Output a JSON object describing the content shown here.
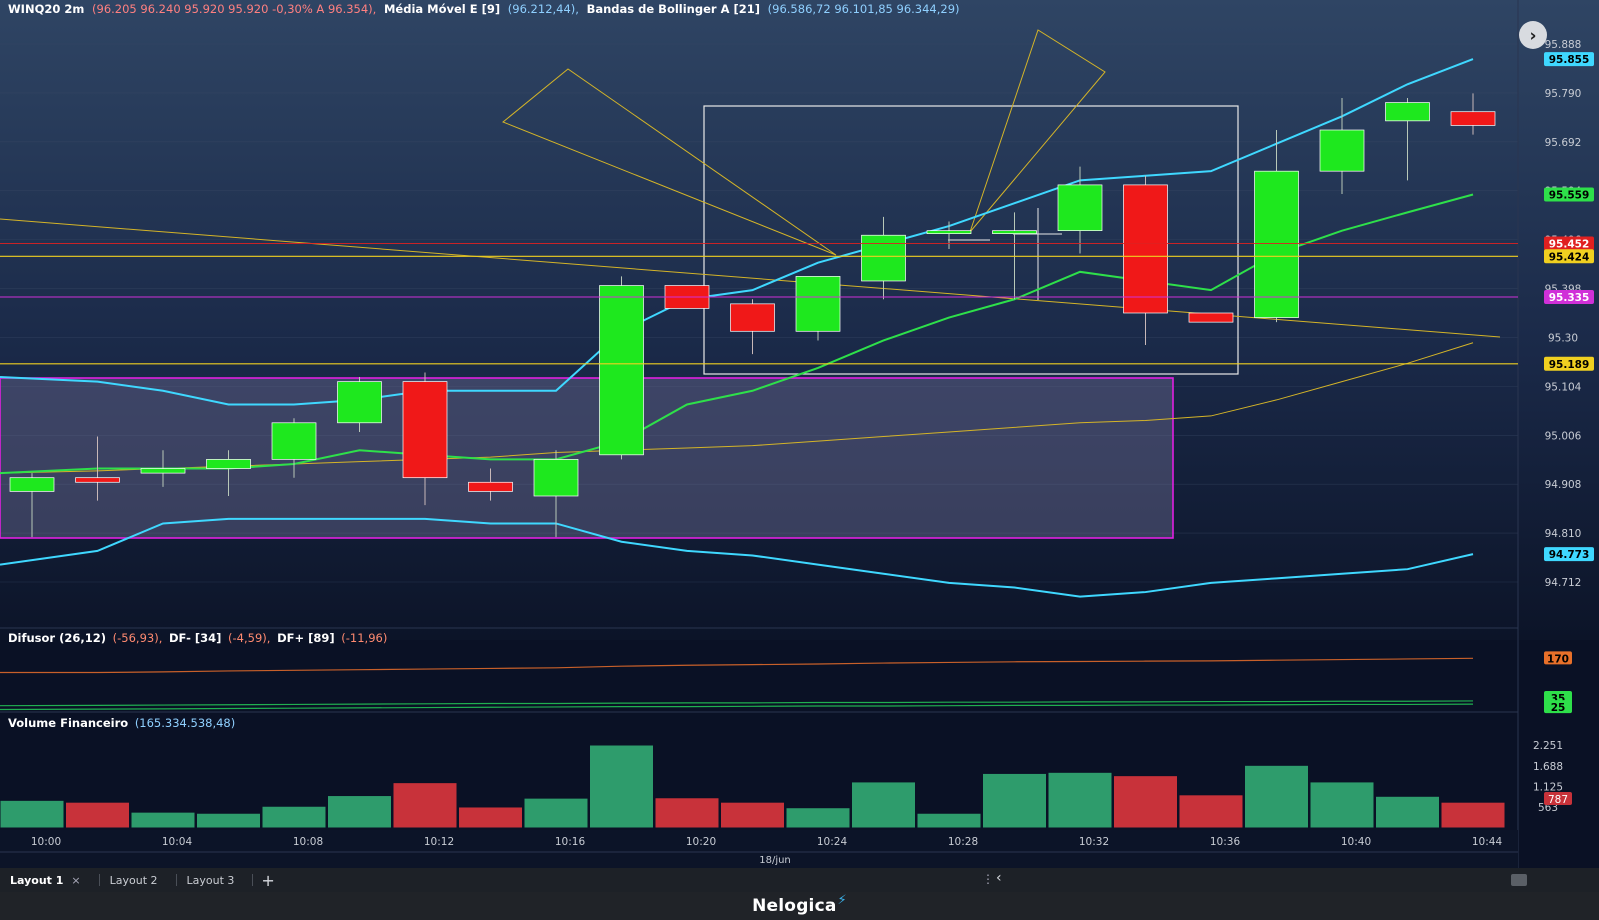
{
  "header": {
    "symbol": "WINQ20 2m",
    "ohlc": "(96.205  96.240  95.920  95.920  -0,30%  A 96.354),",
    "ema_label": "Média Móvel E [9]",
    "ema_values": "(96.212,44),",
    "bb_label": "Bandas de Bollinger A [21]",
    "bb_values": "(96.586,72  96.101,85 96.344,29)"
  },
  "price_axis": {
    "ticks": [
      "95.888",
      "95.790",
      "95.692",
      "95.594",
      "95.496",
      "95.398",
      "95.30",
      "95.104",
      "95.006",
      "94.908",
      "94.810",
      "94.712"
    ]
  },
  "price_labels": [
    {
      "text": "95.855",
      "color": "#3fd8ff"
    },
    {
      "text": "95.559",
      "color": "#2ee04a"
    },
    {
      "text": "95.452",
      "color": "#e02020"
    },
    {
      "text": "95.424",
      "color": "#f0d020"
    },
    {
      "text": "95.335",
      "color": "#d030d8"
    },
    {
      "text": "95.189",
      "color": "#f0d020"
    },
    {
      "text": "94.773",
      "color": "#3fd8ff"
    }
  ],
  "time_axis": {
    "ticks": [
      "10:00",
      "10:04",
      "10:08",
      "10:12",
      "10:16",
      "10:20",
      "10:24",
      "10:28",
      "10:32",
      "10:36",
      "10:40",
      "10:44"
    ],
    "date": "18/jun"
  },
  "difusor": {
    "label": "Difusor (26,12)",
    "value1": "(-56,93),",
    "df_minus": "DF- [34]",
    "value2": "(-4,59),",
    "df_plus": "DF+ [89]",
    "value3": "(-11,96)",
    "badges": [
      {
        "text": "170",
        "color": "#e8702a"
      },
      {
        "text": "35",
        "color": "#2ee04a"
      },
      {
        "text": "25",
        "color": "#2ee04a"
      }
    ]
  },
  "volume": {
    "label": "Volume Financeiro",
    "value": "(165.334.538,48)",
    "ticks": [
      "2.251",
      "1.688",
      "1.125",
      "563"
    ],
    "last_badge": "787"
  },
  "layout_tabs": [
    "Layout 1",
    "Layout 2",
    "Layout 3"
  ],
  "close_glyph": "×",
  "add_glyph": "+",
  "nav_glyph": "›",
  "footer": {
    "brand": "Nelogica"
  },
  "colors": {
    "bg": "#0c1428",
    "up": "#1ee81e",
    "down": "#f01818",
    "bb": "#3fd8ff",
    "ema": "#2ee04a",
    "vol_up": "#2e9c6c",
    "vol_down": "#c8323a"
  },
  "chart_data": {
    "type": "candlestick",
    "title": "WINQ20 2m",
    "x": [
      "10:00",
      "10:02",
      "10:04",
      "10:06",
      "10:08",
      "10:10",
      "10:12",
      "10:14",
      "10:16",
      "10:18",
      "10:20",
      "10:22",
      "10:24",
      "10:26",
      "10:28",
      "10:30",
      "10:32",
      "10:34",
      "10:36",
      "10:38",
      "10:40",
      "10:42",
      "10:44"
    ],
    "candles": [
      {
        "o": 94.91,
        "h": 94.95,
        "l": 94.81,
        "c": 94.94
      },
      {
        "o": 94.94,
        "h": 95.03,
        "l": 94.89,
        "c": 94.93
      },
      {
        "o": 94.95,
        "h": 95.0,
        "l": 94.92,
        "c": 94.96
      },
      {
        "o": 94.96,
        "h": 95.0,
        "l": 94.9,
        "c": 94.98
      },
      {
        "o": 94.98,
        "h": 95.07,
        "l": 94.94,
        "c": 95.06
      },
      {
        "o": 95.06,
        "h": 95.16,
        "l": 95.04,
        "c": 95.15
      },
      {
        "o": 95.15,
        "h": 95.17,
        "l": 94.88,
        "c": 94.94
      },
      {
        "o": 94.93,
        "h": 94.96,
        "l": 94.89,
        "c": 94.91
      },
      {
        "o": 94.9,
        "h": 95.0,
        "l": 94.81,
        "c": 94.98
      },
      {
        "o": 94.99,
        "h": 95.38,
        "l": 94.98,
        "c": 95.36
      },
      {
        "o": 95.36,
        "h": 95.36,
        "l": 95.31,
        "c": 95.31
      },
      {
        "o": 95.32,
        "h": 95.33,
        "l": 95.21,
        "c": 95.26
      },
      {
        "o": 95.26,
        "h": 95.37,
        "l": 95.24,
        "c": 95.38
      },
      {
        "o": 95.37,
        "h": 95.51,
        "l": 95.33,
        "c": 95.47
      },
      {
        "o": 95.48,
        "h": 95.5,
        "l": 95.44,
        "c": 95.48
      },
      {
        "o": 95.48,
        "h": 95.52,
        "l": 95.33,
        "c": 95.48
      },
      {
        "o": 95.48,
        "h": 95.62,
        "l": 95.43,
        "c": 95.58
      },
      {
        "o": 95.58,
        "h": 95.6,
        "l": 95.23,
        "c": 95.3
      },
      {
        "o": 95.3,
        "h": 95.3,
        "l": 95.28,
        "c": 95.28
      },
      {
        "o": 95.29,
        "h": 95.7,
        "l": 95.28,
        "c": 95.61
      },
      {
        "o": 95.61,
        "h": 95.77,
        "l": 95.56,
        "c": 95.7
      },
      {
        "o": 95.72,
        "h": 95.77,
        "l": 95.59,
        "c": 95.76
      },
      {
        "o": 95.74,
        "h": 95.78,
        "l": 95.69,
        "c": 95.71
      }
    ],
    "bb_upper": [
      95.16,
      95.15,
      95.13,
      95.1,
      95.1,
      95.11,
      95.13,
      95.13,
      95.13,
      95.26,
      95.33,
      95.35,
      95.41,
      95.45,
      95.49,
      95.54,
      95.59,
      95.6,
      95.61,
      95.67,
      95.73,
      95.8,
      95.855
    ],
    "bb_lower": [
      94.75,
      94.78,
      94.84,
      94.85,
      94.85,
      94.85,
      94.85,
      94.84,
      94.84,
      94.8,
      94.78,
      94.77,
      94.75,
      94.73,
      94.71,
      94.7,
      94.68,
      94.69,
      94.71,
      94.72,
      94.73,
      94.74,
      94.773
    ],
    "ema": [
      94.95,
      94.96,
      94.96,
      94.96,
      94.97,
      95.0,
      94.99,
      94.98,
      94.98,
      95.02,
      95.1,
      95.13,
      95.18,
      95.24,
      95.29,
      95.33,
      95.39,
      95.37,
      95.35,
      95.43,
      95.48,
      95.52,
      95.559
    ],
    "volume_buy": [
      true,
      false,
      true,
      true,
      true,
      true,
      false,
      false,
      true,
      true,
      false,
      false,
      true,
      true,
      true,
      true,
      true,
      false,
      false,
      true,
      true,
      true,
      false
    ],
    "volume": [
      750,
      700,
      430,
      400,
      590,
      880,
      1230,
      570,
      810,
      2251,
      820,
      700,
      550,
      1250,
      400,
      1480,
      1510,
      1420,
      900,
      1700,
      1250,
      860,
      700
    ],
    "difusor": {
      "orange": [
        125,
        125,
        127,
        130,
        132,
        134,
        136,
        138,
        140,
        145,
        148,
        150,
        152,
        155,
        157,
        159,
        160,
        161,
        162,
        164,
        166,
        168,
        170
      ],
      "green1": [
        20,
        21,
        22,
        23,
        24,
        25,
        26,
        27,
        27,
        28,
        29,
        29,
        30,
        30,
        31,
        31,
        32,
        32,
        33,
        33,
        34,
        34,
        35
      ],
      "green2": [
        8,
        9,
        10,
        11,
        12,
        13,
        14,
        15,
        16,
        17,
        17,
        18,
        19,
        19,
        20,
        21,
        21,
        22,
        22,
        23,
        24,
        24,
        25
      ]
    },
    "horizontal_lines": [
      95.452,
      95.424,
      95.335,
      95.189
    ],
    "ylim": [
      94.66,
      95.94
    ]
  }
}
